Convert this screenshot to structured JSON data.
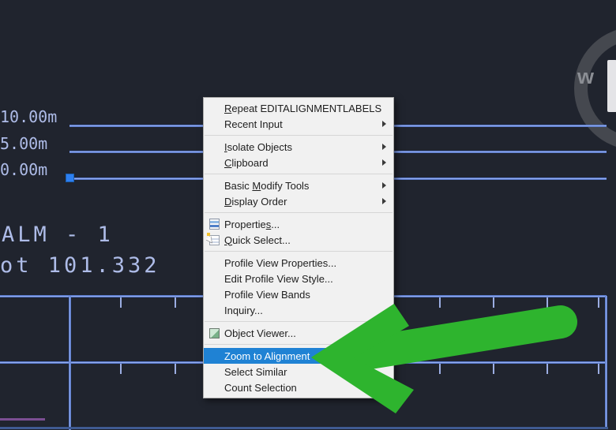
{
  "colors": {
    "background": "#20242e",
    "cad_line_core": "#a9bdf6",
    "cad_line_edge": "#2e55b4",
    "cad_text": "#aebce8",
    "grip_blue": "#2d7ff0",
    "purple_line": "#7b4e92",
    "bottom_line": "#4a69a4",
    "menu_bg": "#f1f1f1",
    "menu_text": "#1e1e1e",
    "menu_highlight": "#1f82d4",
    "arrow_green": "#2eb42e",
    "watermark_gray": "#45484f"
  },
  "cad": {
    "elevation_labels": [
      "10.00m",
      "5.00m",
      "0.00m"
    ],
    "alignment_name": "ALM - 1",
    "station_text": "ot 101.332"
  },
  "watermark": {
    "letter": "w"
  },
  "menu": {
    "items": [
      {
        "label": "Repeat EDITALIGNMENTLABELS",
        "pre": "",
        "u": "R",
        "post": "epeat EDITALIGNMENTLABELS",
        "submenu": false,
        "icon": null,
        "highlighted": false,
        "sep_after": false
      },
      {
        "label": "Recent Input",
        "pre": "Recent Input",
        "u": "",
        "post": "",
        "submenu": true,
        "icon": null,
        "highlighted": false,
        "sep_after": true
      },
      {
        "label": "Isolate Objects",
        "pre": "",
        "u": "I",
        "post": "solate Objects",
        "submenu": true,
        "icon": null,
        "highlighted": false,
        "sep_after": false
      },
      {
        "label": "Clipboard",
        "pre": "",
        "u": "C",
        "post": "lipboard",
        "submenu": true,
        "icon": null,
        "highlighted": false,
        "sep_after": true
      },
      {
        "label": "Basic Modify Tools",
        "pre": "Basic ",
        "u": "M",
        "post": "odify Tools",
        "submenu": true,
        "icon": null,
        "highlighted": false,
        "sep_after": false
      },
      {
        "label": "Display Order",
        "pre": "",
        "u": "D",
        "post": "isplay Order",
        "submenu": true,
        "icon": null,
        "highlighted": false,
        "sep_after": true
      },
      {
        "label": "Properties...",
        "pre": "Propertie",
        "u": "s",
        "post": "...",
        "submenu": false,
        "icon": "properties-icon",
        "highlighted": false,
        "sep_after": false
      },
      {
        "label": "Quick Select...",
        "pre": "",
        "u": "Q",
        "post": "uick Select...",
        "submenu": false,
        "icon": "quick-select-icon",
        "highlighted": false,
        "sep_after": true
      },
      {
        "label": "Profile View Properties...",
        "pre": "Profile View Properties...",
        "u": "",
        "post": "",
        "submenu": false,
        "icon": null,
        "highlighted": false,
        "sep_after": false
      },
      {
        "label": "Edit Profile View Style...",
        "pre": "Edit Profile View Style...",
        "u": "",
        "post": "",
        "submenu": false,
        "icon": null,
        "highlighted": false,
        "sep_after": false
      },
      {
        "label": "Profile View Bands",
        "pre": "Profile View Bands",
        "u": "",
        "post": "",
        "submenu": false,
        "icon": null,
        "highlighted": false,
        "sep_after": false
      },
      {
        "label": "Inquiry...",
        "pre": "Inquiry...",
        "u": "",
        "post": "",
        "submenu": false,
        "icon": null,
        "highlighted": false,
        "sep_after": true
      },
      {
        "label": "Object Viewer...",
        "pre": "Object Viewer...",
        "u": "",
        "post": "",
        "submenu": false,
        "icon": "object-viewer-icon",
        "highlighted": false,
        "sep_after": true
      },
      {
        "label": "Zoom to Alignment",
        "pre": "Zoom to Alignment",
        "u": "",
        "post": "",
        "submenu": false,
        "icon": null,
        "highlighted": true,
        "sep_after": false
      },
      {
        "label": "Select Similar",
        "pre": "Select Similar",
        "u": "",
        "post": "",
        "submenu": false,
        "icon": null,
        "highlighted": false,
        "sep_after": false
      },
      {
        "label": "Count Selection",
        "pre": "Count Selection",
        "u": "",
        "post": "",
        "submenu": false,
        "icon": null,
        "highlighted": false,
        "sep_after": false
      }
    ]
  }
}
